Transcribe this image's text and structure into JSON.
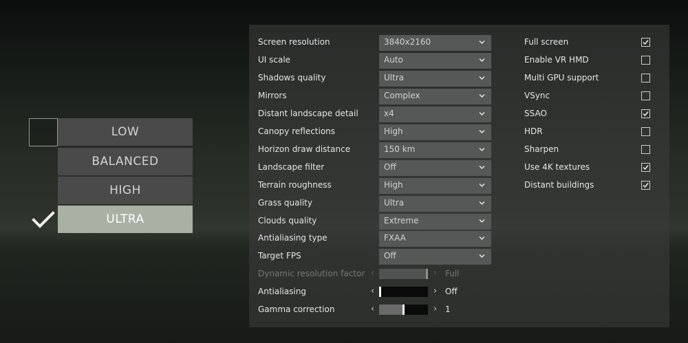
{
  "presets": {
    "items": [
      {
        "label": "LOW",
        "selected": false
      },
      {
        "label": "BALANCED",
        "selected": false
      },
      {
        "label": "HIGH",
        "selected": false
      },
      {
        "label": "ULTRA",
        "selected": true
      }
    ],
    "selected_icon": "checkmark-icon"
  },
  "settings": {
    "dropdowns": [
      {
        "label": "Screen resolution",
        "value": "3840x2160"
      },
      {
        "label": "UI scale",
        "value": "Auto"
      },
      {
        "label": "Shadows quality",
        "value": "Ultra"
      },
      {
        "label": "Mirrors",
        "value": "Complex"
      },
      {
        "label": "Distant landscape detail",
        "value": "x4"
      },
      {
        "label": "Canopy reflections",
        "value": "High"
      },
      {
        "label": "Horizon draw distance",
        "value": "150 km"
      },
      {
        "label": "Landscape filter",
        "value": "Off"
      },
      {
        "label": "Terrain roughness",
        "value": "High"
      },
      {
        "label": "Grass quality",
        "value": "Ultra"
      },
      {
        "label": "Clouds quality",
        "value": "Extreme"
      },
      {
        "label": "Antialiasing type",
        "value": "FXAA"
      },
      {
        "label": "Target FPS",
        "value": "Off"
      }
    ],
    "sliders": [
      {
        "label": "Dynamic resolution factor",
        "value": "Full",
        "level": 1.0,
        "disabled": true
      },
      {
        "label": "Antialiasing",
        "value": "Off",
        "level": 0.0,
        "disabled": false
      },
      {
        "label": "Gamma correction",
        "value": "1",
        "level": 0.5,
        "disabled": false
      }
    ],
    "slider_arrows": {
      "left": "‹",
      "right": "›"
    },
    "checkboxes": [
      {
        "label": "Full screen",
        "checked": true
      },
      {
        "label": "Enable VR HMD",
        "checked": false
      },
      {
        "label": "Multi GPU support",
        "checked": false
      },
      {
        "label": "VSync",
        "checked": false
      },
      {
        "label": "SSAO",
        "checked": true
      },
      {
        "label": "HDR",
        "checked": false
      },
      {
        "label": "Sharpen",
        "checked": false
      },
      {
        "label": "Use 4K textures",
        "checked": true
      },
      {
        "label": "Distant buildings",
        "checked": true
      }
    ]
  },
  "colors": {
    "preset_default": "#4a4a4a",
    "preset_selected": "#a9b1a5",
    "panel": "#3a3c3a",
    "select": "#555857"
  }
}
